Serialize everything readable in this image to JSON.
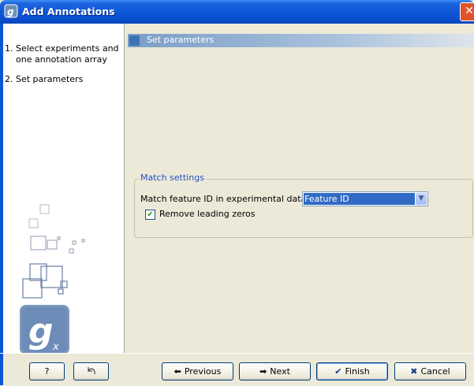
{
  "window": {
    "title": "Add Annotations",
    "close_icon": "close-icon"
  },
  "steps": [
    {
      "num": "1.",
      "label_line1": "Select experiments and",
      "label_line2": "one annotation array"
    },
    {
      "num": "2.",
      "label_line1": "Set parameters"
    }
  ],
  "section": {
    "title": "Set parameters"
  },
  "match_settings": {
    "legend": "Match settings",
    "match_label": "Match feature ID in experimental data to",
    "selected_option": "Feature ID",
    "remove_zeros_label": "Remove leading zeros",
    "remove_zeros_checked": true
  },
  "buttons": {
    "help": "?",
    "previous": "Previous",
    "next": "Next",
    "finish": "Finish",
    "cancel": "Cancel"
  },
  "colors": {
    "title_bar": "#0a55d6",
    "accent": "#316ac5",
    "legend": "#2151c7"
  }
}
